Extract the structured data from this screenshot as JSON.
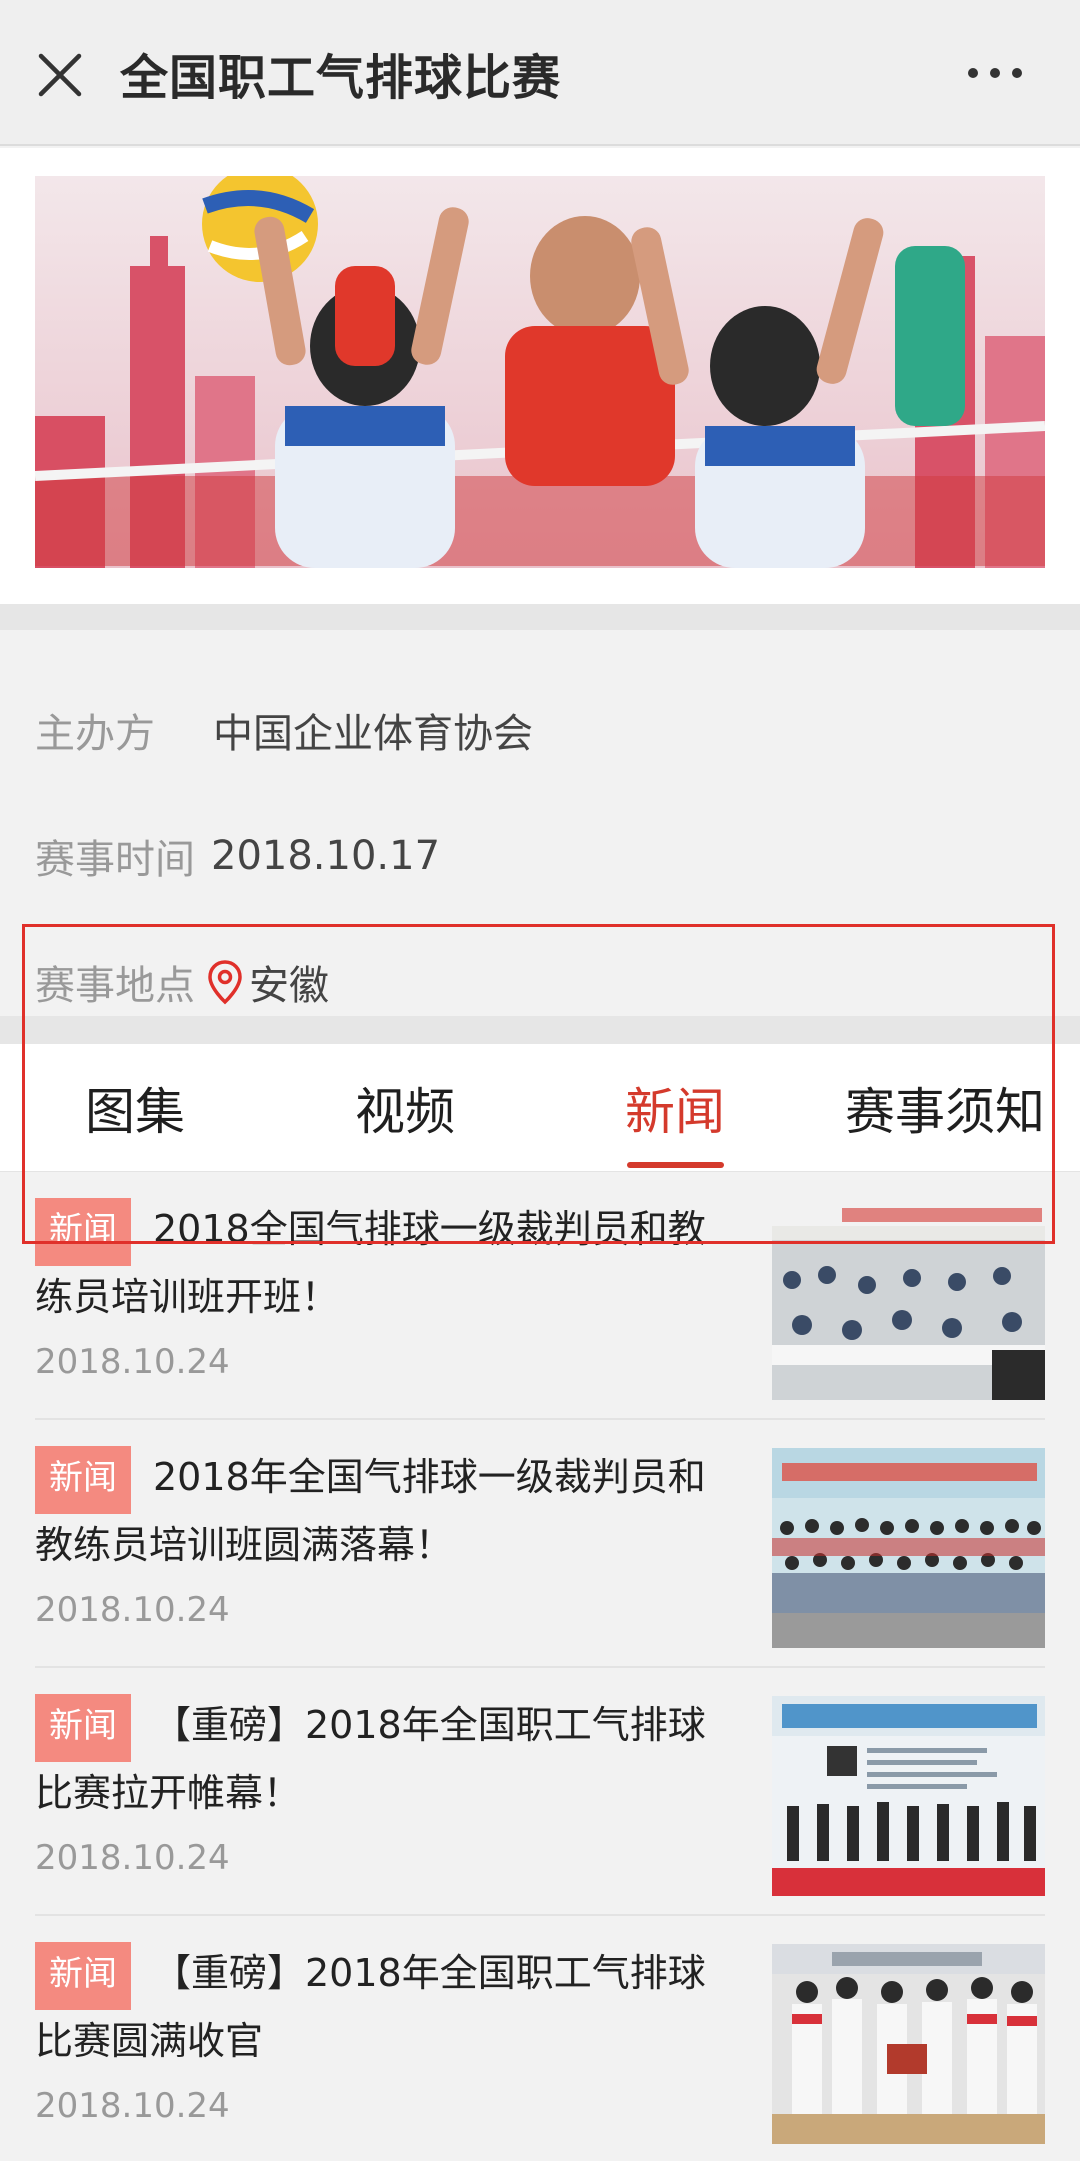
{
  "header": {
    "title": "全国职工气排球比赛",
    "close_icon": "close-icon",
    "more_icon": "more-icon"
  },
  "banner": {
    "alt": "volleyball-match-photo"
  },
  "info": {
    "organizer_label": "主办方",
    "organizer_value": "中国企业体育协会",
    "time_label": "赛事时间",
    "time_value": "2018.10.17",
    "location_label": "赛事地点",
    "location_value": "安徽",
    "location_icon": "location-pin-icon"
  },
  "tabs": [
    {
      "label": "图集",
      "active": false
    },
    {
      "label": "视频",
      "active": false
    },
    {
      "label": "新闻",
      "active": true
    },
    {
      "label": "赛事须知",
      "active": false
    }
  ],
  "news": [
    {
      "badge": "新闻",
      "title": "2018全国气排球一级裁判员和教练员培训班开班！",
      "date": "2018.10.24"
    },
    {
      "badge": "新闻",
      "title": "2018年全国气排球一级裁判员和教练员培训班圆满落幕！",
      "date": "2018.10.24"
    },
    {
      "badge": "新闻",
      "title": "【重磅】2018年全国职工气排球比赛拉开帷幕！",
      "date": "2018.10.24"
    },
    {
      "badge": "新闻",
      "title": "【重磅】2018年全国职工气排球比赛圆满收官",
      "date": "2018.10.24"
    }
  ],
  "colors": {
    "accent": "#d43a2c",
    "badge": "#f48a80",
    "highlight_frame": "#e0302a"
  }
}
